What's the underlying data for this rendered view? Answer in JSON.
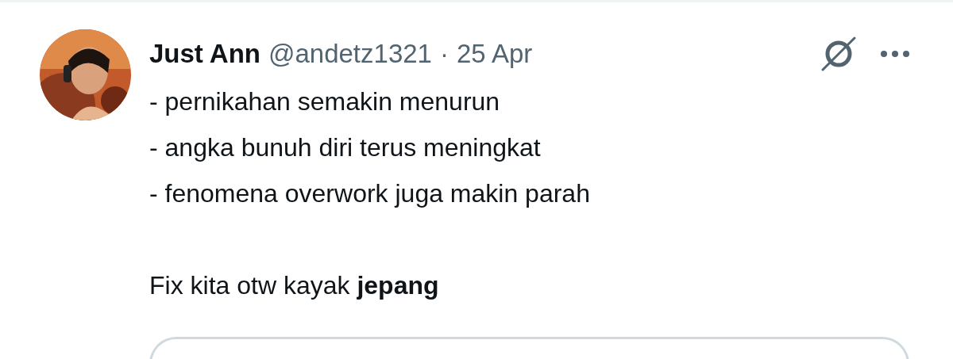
{
  "tweet": {
    "author": {
      "name": "Just Ann",
      "handle": "@andetz1321",
      "separator": "·",
      "time": "25 Apr"
    },
    "body": [
      "- pernikahan semakin menurun",
      "- angka bunuh diri terus meningkat",
      "- fenomena overwork juga makin parah"
    ],
    "closing": "Fix kita otw kayak **jepang**",
    "quoted": {
      "kind": "card"
    }
  }
}
